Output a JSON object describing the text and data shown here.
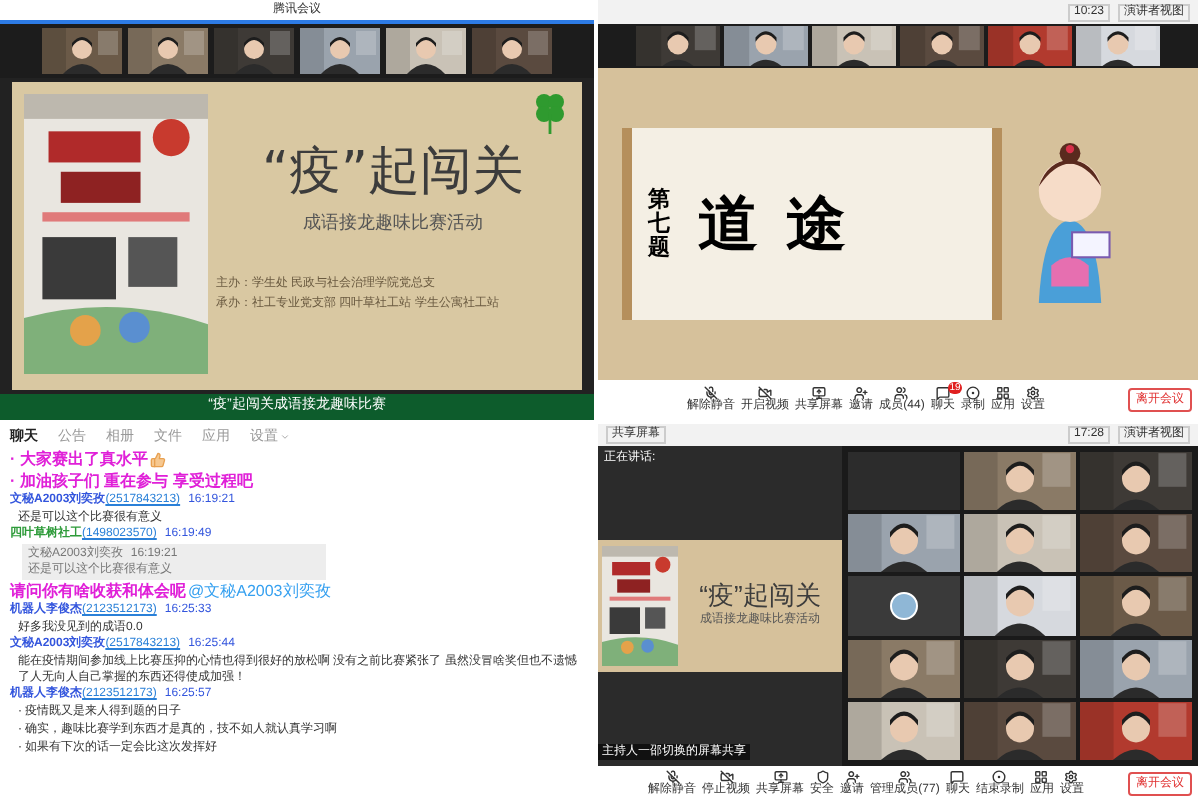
{
  "meeting_left": {
    "title": "腾讯会议",
    "strip": [
      {
        "kind": "picture"
      },
      {
        "kind": "picture"
      },
      {
        "kind": "picture"
      },
      {
        "kind": "picture"
      },
      {
        "kind": "picture"
      },
      {
        "kind": "picture"
      }
    ],
    "slide": {
      "title": "“疫”起闯关",
      "subtitle": "成语接龙趣味比赛活动",
      "lines": [
        "主办：学生处  民政与社会治理学院党总支",
        "承办：社工专业党支部  四叶草社工站  学生公寓社工站"
      ]
    },
    "banner": "“疫”起闯关成语接龙趣味比赛"
  },
  "meeting_right": {
    "time": "10:23",
    "view": "演讲者视图",
    "strip": [
      {
        "kind": "picture"
      },
      {
        "kind": "picture"
      },
      {
        "kind": "picture"
      },
      {
        "kind": "picture"
      },
      {
        "kind": "picture"
      },
      {
        "kind": "picture"
      }
    ],
    "slide": {
      "question": "第七题",
      "words": [
        "道",
        "途"
      ]
    },
    "toolbar": [
      {
        "kind": "mic",
        "label": "解除静音"
      },
      {
        "kind": "video",
        "label": "开启视频"
      },
      {
        "kind": "share",
        "label": "共享屏幕"
      },
      {
        "kind": "invite",
        "label": "邀请"
      },
      {
        "kind": "members",
        "label": "成员(44)"
      },
      {
        "kind": "chat",
        "label": "聊天",
        "badge": "19"
      },
      {
        "kind": "record",
        "label": "录制"
      },
      {
        "kind": "apps",
        "label": "应用"
      },
      {
        "kind": "settings",
        "label": "设置"
      }
    ],
    "leave": "离开会议"
  },
  "chat": {
    "tabs": [
      {
        "label": "聊天",
        "selected": true
      },
      {
        "label": "公告",
        "selected": false
      },
      {
        "label": "相册",
        "selected": false
      },
      {
        "label": "文件",
        "selected": false
      },
      {
        "label": "应用",
        "selected": false
      },
      {
        "label": "设置",
        "selected": false
      }
    ],
    "messages": [
      {
        "kind": "shout",
        "text": "· 大家赛出了真水平",
        "thumbs": true
      },
      {
        "kind": "shout",
        "text": "· 加油孩子们  重在参与  享受过程吧",
        "thumbs": false
      },
      {
        "kind": "sender",
        "name": "文秘A2003刘奕孜",
        "qq": "(2517843213)",
        "time": "16:19:21",
        "color": "#3355dd"
      },
      {
        "kind": "text",
        "text": "还是可以这个比赛很有意义"
      },
      {
        "kind": "sender",
        "name": "四叶草树社工",
        "qq": "(1498023570)",
        "time": "16:19:49",
        "color": "#2e9b3a"
      },
      {
        "kind": "quote",
        "name": "文秘A2003刘奕孜",
        "time": "16:19:21",
        "text": "还是可以这个比赛很有意义"
      },
      {
        "kind": "shout",
        "text": "请问你有啥收获和体会呢",
        "mention": "@文秘A2003刘奕孜",
        "thumbs": false
      },
      {
        "kind": "sender",
        "name": "机器人李俊杰",
        "qq": "(2123512173)",
        "time": "16:25:33",
        "color": "#3355dd"
      },
      {
        "kind": "text",
        "text": "好多我没见到的成语0.0"
      },
      {
        "kind": "sender",
        "name": "文秘A2003刘奕孜",
        "qq": "(2517843213)",
        "time": "16:25:44",
        "color": "#3355dd"
      },
      {
        "kind": "text",
        "text": "能在疫情期间参加线上比赛压抑的心情也得到很好的放松啊 没有之前比赛紧张了 虽然没冒啥奖但也不遗憾了人无向人自己掌握的东西还得使成加强！"
      },
      {
        "kind": "sender",
        "name": "机器人李俊杰",
        "qq": "(2123512173)",
        "time": "16:25:57",
        "color": "#3355dd"
      },
      {
        "kind": "text",
        "text": "· 疫情既又是来人得到题的日子"
      },
      {
        "kind": "text",
        "text": "· 确实，趣味比赛学到东西才是真的，技不如人就认真学习啊"
      },
      {
        "kind": "text",
        "text": "· 如果有下次的话一定会比这次发挥好"
      }
    ]
  },
  "meeting_gallery": {
    "share": "共享屏幕",
    "time": "17:28",
    "view": "演讲者视图",
    "speaking": "正在讲话:",
    "caption": "主持人一邵切换的屏幕共享",
    "slide": {
      "title": "“疫”起闯关",
      "subtitle": "成语接龙趣味比赛活动"
    },
    "tiles": [
      {
        "kind": "empty"
      },
      {
        "kind": "picture"
      },
      {
        "kind": "picture"
      },
      {
        "kind": "picture"
      },
      {
        "kind": "picture"
      },
      {
        "kind": "picture"
      },
      {
        "kind": "avatar"
      },
      {
        "kind": "picture"
      },
      {
        "kind": "picture"
      },
      {
        "kind": "picture"
      },
      {
        "kind": "picture"
      },
      {
        "kind": "picture"
      },
      {
        "kind": "picture"
      },
      {
        "kind": "picture"
      },
      {
        "kind": "picture"
      }
    ],
    "toolbar": [
      {
        "kind": "mic",
        "label": "解除静音"
      },
      {
        "kind": "video",
        "label": "停止视频"
      },
      {
        "kind": "share",
        "label": "共享屏幕"
      },
      {
        "kind": "security",
        "label": "安全"
      },
      {
        "kind": "invite",
        "label": "邀请"
      },
      {
        "kind": "members",
        "label": "管理成员(77)"
      },
      {
        "kind": "chat",
        "label": "聊天"
      },
      {
        "kind": "record",
        "label": "结束录制"
      },
      {
        "kind": "apps",
        "label": "应用"
      },
      {
        "kind": "settings",
        "label": "设置"
      }
    ],
    "leave": "离开会议"
  }
}
